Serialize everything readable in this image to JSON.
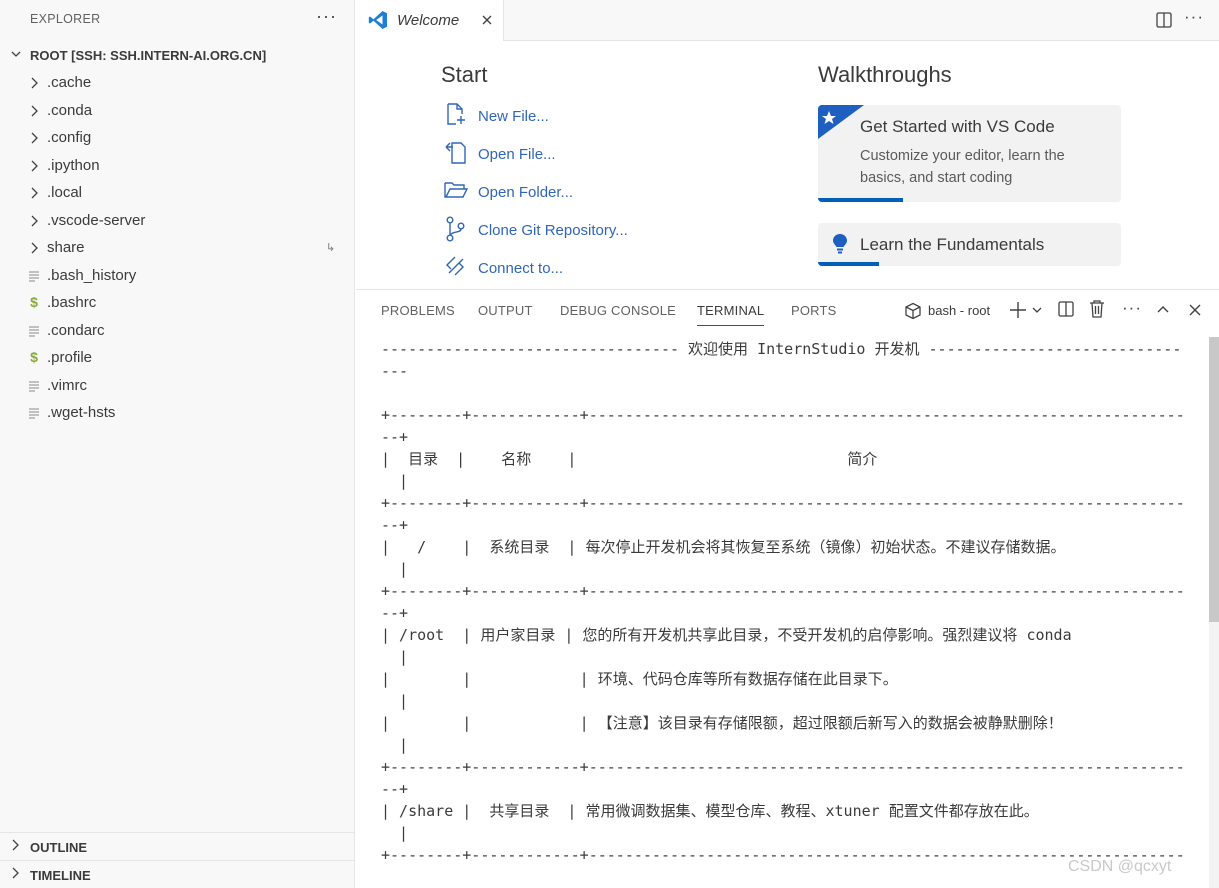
{
  "explorer": {
    "header": "EXPLORER",
    "more": "···",
    "root_label": "ROOT [SSH: SSH.INTERN-AI.ORG.CN]",
    "items": [
      {
        "label": ".cache",
        "kind": "folder",
        "icon": "chevron-right-icon"
      },
      {
        "label": ".conda",
        "kind": "folder",
        "icon": "chevron-right-icon"
      },
      {
        "label": ".config",
        "kind": "folder",
        "icon": "chevron-right-icon"
      },
      {
        "label": ".ipython",
        "kind": "folder",
        "icon": "chevron-right-icon"
      },
      {
        "label": ".local",
        "kind": "folder",
        "icon": "chevron-right-icon"
      },
      {
        "label": ".vscode-server",
        "kind": "folder",
        "icon": "chevron-right-icon"
      },
      {
        "label": "share",
        "kind": "folder",
        "icon": "chevron-right-icon",
        "symlink": true
      },
      {
        "label": ".bash_history",
        "kind": "file",
        "icon": "text-file-icon"
      },
      {
        "label": ".bashrc",
        "kind": "shell",
        "icon": "shell-file-icon"
      },
      {
        "label": ".condarc",
        "kind": "file",
        "icon": "text-file-icon"
      },
      {
        "label": ".profile",
        "kind": "shell",
        "icon": "shell-file-icon"
      },
      {
        "label": ".vimrc",
        "kind": "file",
        "icon": "text-file-icon"
      },
      {
        "label": ".wget-hsts",
        "kind": "file",
        "icon": "text-file-icon"
      }
    ],
    "outline": "OUTLINE",
    "timeline": "TIMELINE"
  },
  "tabs": {
    "welcome_title": "Welcome",
    "more": "···"
  },
  "welcome": {
    "start_title": "Start",
    "start_items": [
      {
        "label": "New File...",
        "icon": "new-file-icon"
      },
      {
        "label": "Open File...",
        "icon": "open-file-icon"
      },
      {
        "label": "Open Folder...",
        "icon": "open-folder-icon"
      },
      {
        "label": "Clone Git Repository...",
        "icon": "git-branch-icon"
      },
      {
        "label": "Connect to...",
        "icon": "remote-connect-icon"
      }
    ],
    "walkthroughs_title": "Walkthroughs",
    "card1": {
      "title": "Get Started with VS Code",
      "description": "Customize your editor, learn the basics, and start coding",
      "progress": 0.28
    },
    "card2": {
      "title": "Learn the Fundamentals",
      "progress": 0.2
    }
  },
  "panel": {
    "tabs": [
      "PROBLEMS",
      "OUTPUT",
      "DEBUG CONSOLE",
      "TERMINAL",
      "PORTS"
    ],
    "active_tab": "TERMINAL",
    "shell_label": "bash - root"
  },
  "terminal": {
    "lines": [
      "--------------------------------- 欢迎使用 InternStudio 开发机 ----------------------------",
      "---",
      "",
      "+--------+------------+------------------------------------------------------------------",
      "--+",
      "|  目录  |    名称    |                              简介",
      "  |",
      "+--------+------------+------------------------------------------------------------------",
      "--+",
      "|   /    |  系统目录  | 每次停止开发机会将其恢复至系统（镜像）初始状态。不建议存储数据。",
      "  |",
      "+--------+------------+------------------------------------------------------------------",
      "--+",
      "| /root  | 用户家目录 | 您的所有开发机共享此目录，不受开发机的启停影响。强烈建议将 conda",
      "  |",
      "|        |            | 环境、代码仓库等所有数据存储在此目录下。",
      "  |",
      "|        |            | 【注意】该目录有存储限额，超过限额后新写入的数据会被静默删除！",
      "  |",
      "+--------+------------+------------------------------------------------------------------",
      "--+",
      "| /share |  共享目录  | 常用微调数据集、模型仓库、教程、xtuner 配置文件都存放在此。",
      "  |",
      "+--------+------------+------------------------------------------------------------------"
    ]
  },
  "watermark": "CSDN @qcxyt",
  "colors": {
    "accent": "#005fb8",
    "link": "#3066b8",
    "shell_icon": "#89a93a"
  }
}
